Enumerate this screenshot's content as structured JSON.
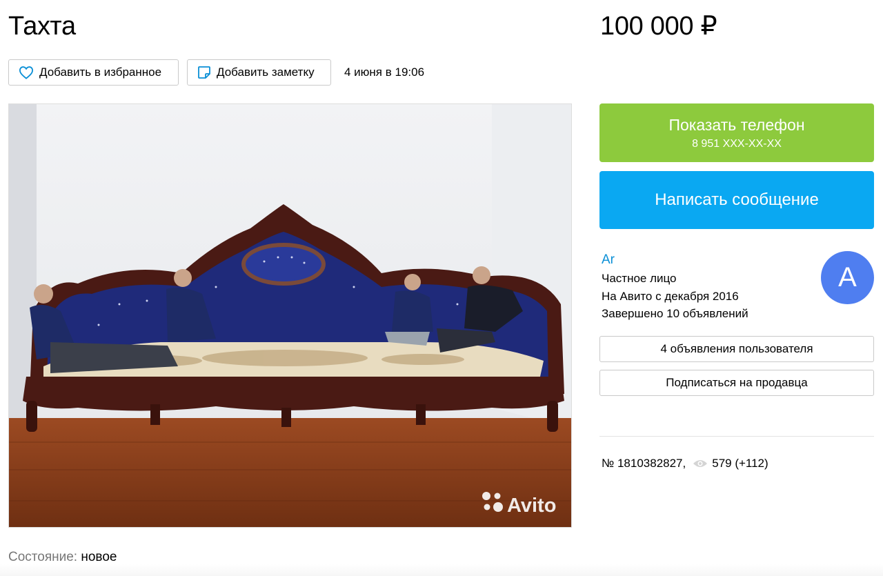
{
  "listing": {
    "title": "Тахта",
    "price": "100 000 ₽",
    "date": "4 июня в 19:06",
    "condition_key": "Состояние:",
    "condition_value": "новое",
    "number": "№ 1810382827,",
    "views": "579 (+112)"
  },
  "actions": {
    "favorite_label": "Добавить в избранное",
    "note_label": "Добавить заметку",
    "phone_label": "Показать телефон",
    "phone_number": "8 951 XXX-XX-XX",
    "message_label": "Написать сообщение"
  },
  "seller": {
    "name": "Ar",
    "type": "Частное лицо",
    "since": "На Авито с декабря 2016",
    "completed": "Завершено 10 объявлений",
    "avatar_letter": "A",
    "listings_button": "4 объявления пользователя",
    "subscribe_button": "Подписаться на продавца"
  },
  "photo": {
    "watermark": "Avito"
  },
  "icons": {
    "favorite": "heart-icon",
    "note": "note-icon",
    "views": "eye-icon"
  },
  "colors": {
    "green": "#8dca3d",
    "blue": "#0aa8f2",
    "link": "#0a8fd6",
    "avatar": "#4f7ef0"
  }
}
